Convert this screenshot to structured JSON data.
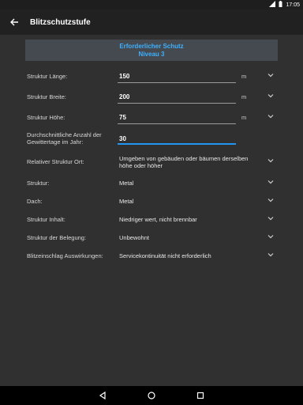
{
  "status_bar": {
    "time": "17:05"
  },
  "toolbar": {
    "title": "Blitzschutzstufe"
  },
  "banner": {
    "line1": "Erforderlicher Schutz",
    "line2": "Niveau 3"
  },
  "fields": {
    "laenge": {
      "label": "Struktur Länge:",
      "value": "150",
      "unit": "m"
    },
    "breite": {
      "label": "Struktur Breite:",
      "value": "200",
      "unit": "m"
    },
    "hoehe": {
      "label": "Struktur Höhe:",
      "value": "75",
      "unit": "m"
    },
    "gewitter": {
      "label": "Durchschnittliche Anzahl der Gewittertage im Jahr:",
      "value": "30"
    },
    "ort": {
      "label": "Relativer Struktur Ort:",
      "value": "Umgeben von gebäuden oder bäumen derselben höhe oder höher"
    },
    "struktur": {
      "label": "Struktur:",
      "value": "Metal"
    },
    "dach": {
      "label": "Dach:",
      "value": "Metal"
    },
    "inhalt": {
      "label": "Struktur Inhalt:",
      "value": "Niedriger wert, nicht brennbar"
    },
    "belegung": {
      "label": "Struktur der Belegung:",
      "value": "Unbewohnt"
    },
    "auswirkungen": {
      "label": "Blitzeinschlag Auswirkungen:",
      "value": "Servicekontinuität nicht erforderlich"
    }
  },
  "icons": {
    "back": "arrow-left-icon",
    "chevron": "chevron-down-icon",
    "nav_back": "triangle-back-icon",
    "nav_home": "circle-home-icon",
    "nav_recents": "square-recents-icon"
  },
  "colors": {
    "accent": "#3fb0ff",
    "toolbar": "#212121",
    "background": "#303030",
    "banner": "#444a4f",
    "active_underline": "#2196f3"
  }
}
